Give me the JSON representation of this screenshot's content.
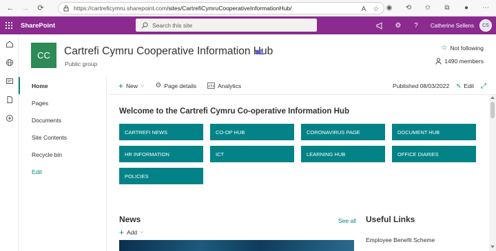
{
  "browser": {
    "url_prefix": "https://cartreficymru.sharepoint.com",
    "url_path": "/sites/CartrefiCymruCooperativeInformationHub/"
  },
  "suite": {
    "brand": "SharePoint",
    "search_placeholder": "Search this site",
    "user_name": "Catherine Sellens",
    "user_initials": "CS"
  },
  "site": {
    "logo_initials": "CC",
    "title": "Cartrefi Cymru Cooperative Information Hub",
    "subtitle": "Public group",
    "follow_label": "Not following",
    "members_label": "1490 members"
  },
  "leftnav": {
    "items": [
      {
        "label": "Home",
        "active": true
      },
      {
        "label": "Pages"
      },
      {
        "label": "Documents"
      },
      {
        "label": "Site Contents"
      },
      {
        "label": "Recycle bin"
      }
    ],
    "edit_label": "Edit"
  },
  "cmdbar": {
    "new_label": "New",
    "page_details_label": "Page details",
    "analytics_label": "Analytics",
    "published_label": "Published 08/03/2022",
    "edit_label": "Edit"
  },
  "main": {
    "welcome": "Welcome to the Cartrefi Cymru Co-operative Information Hub",
    "tiles": [
      "CARTREFI NEWS",
      "CO-OP HUB",
      "CORONAVIRUS PAGE",
      "DOCUMENT HUB",
      "HR INFORMATION",
      "ICT",
      "LEARNING HUB",
      "OFFICE DIARIES",
      "POLICIES"
    ],
    "news_title": "News",
    "see_all": "See all",
    "add_label": "Add",
    "useful_title": "Useful Links",
    "useful_link": "Employee Benefit Scheme"
  },
  "colors": {
    "suite_bar": "#8b2a8f",
    "accent": "#038387",
    "logo": "#2e8b57"
  }
}
